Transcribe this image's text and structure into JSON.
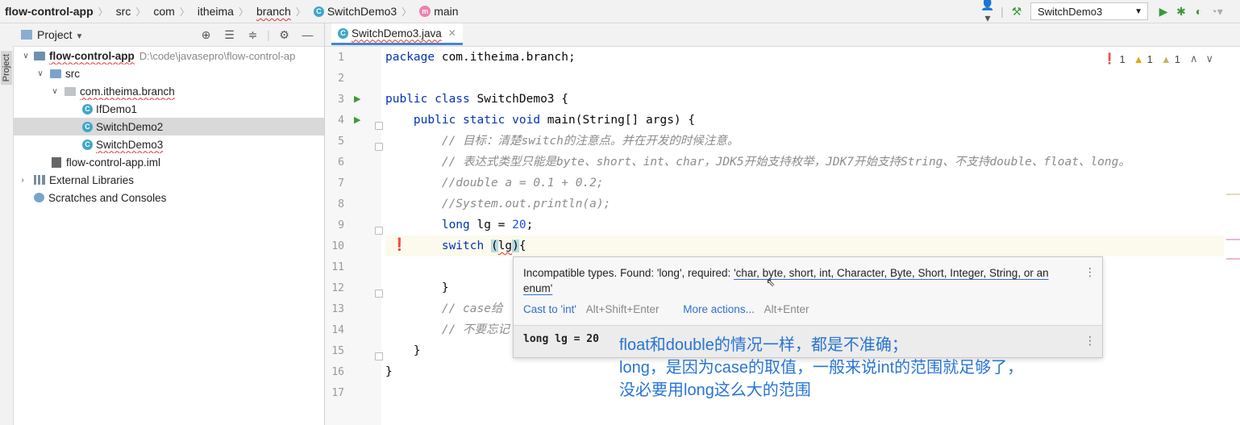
{
  "breadcrumb": [
    {
      "label": "flow-control-app",
      "icon": "none"
    },
    {
      "label": "src",
      "icon": "none"
    },
    {
      "label": "com",
      "icon": "none"
    },
    {
      "label": "itheima",
      "icon": "none"
    },
    {
      "label": "branch",
      "icon": "none"
    },
    {
      "label": "SwitchDemo3",
      "icon": "class-icon"
    },
    {
      "label": "main",
      "icon": "method-icon"
    }
  ],
  "toolbar": {
    "run_config": "SwitchDemo3"
  },
  "sidebar": {
    "stripe_label": "Project",
    "panel_title": "Project"
  },
  "tree": [
    {
      "label": "flow-control-app",
      "path": "D:\\code\\javasepro\\flow-control-ap",
      "indent": 0,
      "arrow": "▾",
      "icon": "module-icon",
      "bold": true
    },
    {
      "label": "src",
      "path": "",
      "indent": 1,
      "arrow": "▾",
      "icon": "folder-icon",
      "bold": false
    },
    {
      "label": "com.itheima.branch",
      "path": "",
      "indent": 2,
      "arrow": "▾",
      "icon": "package-icon",
      "bold": false
    },
    {
      "label": "IfDemo1",
      "path": "",
      "indent": 3,
      "arrow": "",
      "icon": "class-icon",
      "bold": false
    },
    {
      "label": "SwitchDemo2",
      "path": "",
      "indent": 3,
      "arrow": "",
      "icon": "class-icon",
      "bold": false,
      "selected": true
    },
    {
      "label": "SwitchDemo3",
      "path": "",
      "indent": 3,
      "arrow": "",
      "icon": "class-icon",
      "bold": false
    },
    {
      "label": "flow-control-app.iml",
      "path": "",
      "indent": 2,
      "arrow": "",
      "icon": "iml-icon",
      "bold": false
    },
    {
      "label": "External Libraries",
      "path": "",
      "indent": 0,
      "arrow": "›",
      "icon": "libraries-icon",
      "bold": false
    },
    {
      "label": "Scratches and Consoles",
      "path": "",
      "indent": 0,
      "arrow": "",
      "icon": "scratches-icon",
      "bold": false
    }
  ],
  "editor": {
    "tab_label": "SwitchDemo3.java",
    "inspections": {
      "errors": "1",
      "warnings": "1",
      "weak_warnings": "1"
    },
    "lines": [
      "package com.itheima.branch;",
      "",
      "public class SwitchDemo3 {",
      "    public static void main(String[] args) {",
      "        // 目标：清楚switch的注意点。并在开发的时候注意。",
      "        // 表达式类型只能是byte、short、int、char，JDK5开始支持枚举，JDK7开始支持String、不支持double、float、long。",
      "        //double a = 0.1 + 0.2;",
      "        //System.out.println(a);",
      "        long lg = 20;",
      "        switch (lg){",
      "",
      "        }",
      "        // case给",
      "        // 不要忘记",
      "    }",
      "}",
      ""
    ]
  },
  "popup": {
    "message_prefix": "Incompatible types. Found: 'long', required: ",
    "message_required": "'char, byte, short, int, Character, Byte, Short, Integer, String, or an enum'",
    "action1_label": "Cast to 'int'",
    "action1_shortcut": "Alt+Shift+Enter",
    "action2_label": "More actions...",
    "action2_shortcut": "Alt+Enter",
    "decl_type": "long",
    "decl_rest": " lg = 20"
  },
  "overlay_note": {
    "line1": "float和double的情况一样，都是不准确；",
    "line2": "long，是因为case的取值，一般来说int的范围就足够了，",
    "line3": "没必要用long这么大的范围"
  },
  "colors": {
    "keyword": "#0033b3",
    "comment": "#8c8c8c",
    "number": "#1750eb",
    "link": "#2f6fd0",
    "overlay": "#2874d4"
  }
}
